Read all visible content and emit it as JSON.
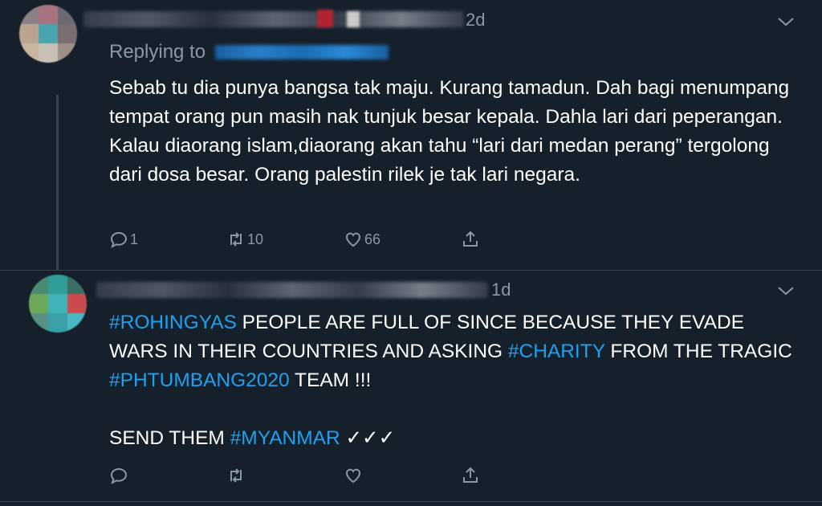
{
  "tweets": [
    {
      "timestamp": "2d",
      "reply_prefix": "Replying to",
      "text": "Sebab tu dia punya bangsa tak maju. Kurang tamadun. Dah bagi menumpang tempat orang pun masih nak tunjuk besar kepala. Dahla lari dari peperangan. Kalau diaorang islam,diaorang akan tahu “lari dari medan perang” tergolong dari dosa besar. Orang palestin rilek je tak lari negara.",
      "reply_count": "1",
      "retweet_count": "10",
      "like_count": "66"
    },
    {
      "timestamp": "1d",
      "hashtag_rohingyas": "#ROHINGYAS",
      "text_part1": " PEOPLE ARE FULL OF SINCE BECAUSE THEY EVADE WARS IN THEIR COUNTRIES AND ASKING ",
      "hashtag_charity": "#CHARITY",
      "text_part2": " FROM THE TRAGIC ",
      "hashtag_phtumbang": "#PHTUMBANG2020",
      "text_part3": " TEAM !!!",
      "send_prefix": "SEND THEM ",
      "hashtag_myanmar": "#MYANMAR",
      "send_suffix": " ✓✓✓"
    }
  ],
  "colors": {
    "background": "#15202b",
    "secondary_text": "#8899a6",
    "hashtag": "#1da1f2",
    "divider": "#38444d"
  }
}
